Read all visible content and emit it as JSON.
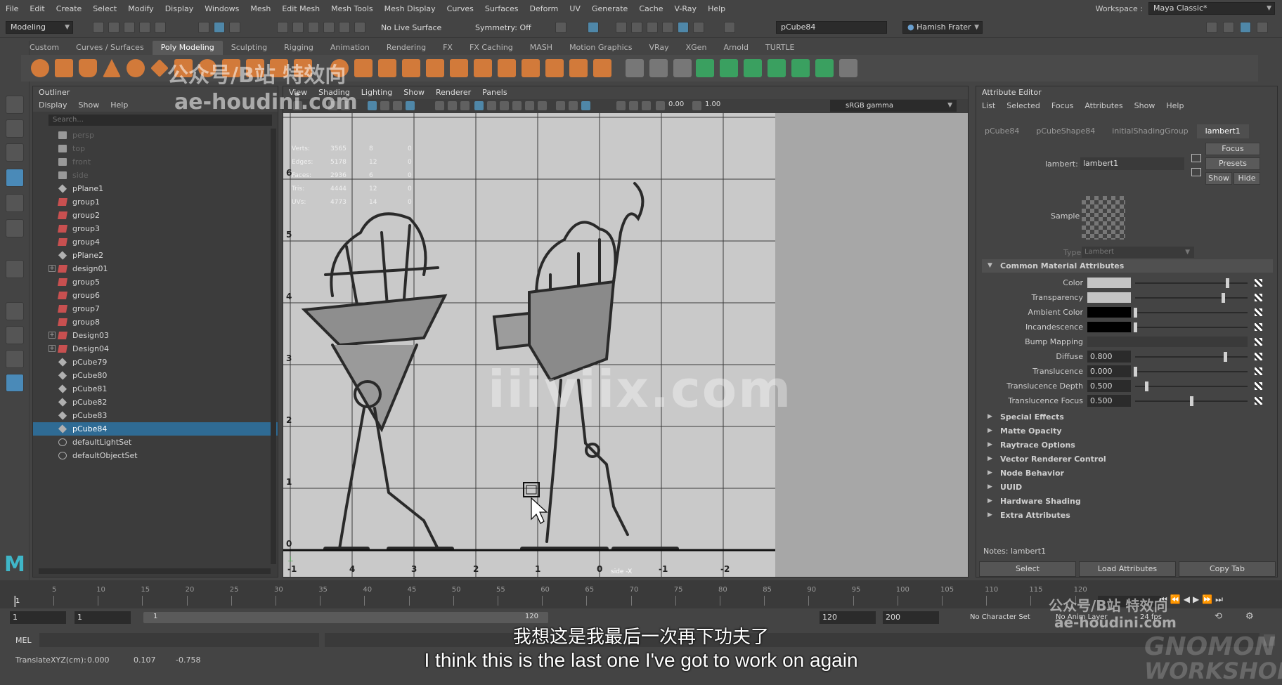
{
  "menubar": {
    "items": [
      "File",
      "Edit",
      "Create",
      "Select",
      "Modify",
      "Display",
      "Windows",
      "Mesh",
      "Edit Mesh",
      "Mesh Tools",
      "Mesh Display",
      "Curves",
      "Surfaces",
      "Deform",
      "UV",
      "Generate",
      "Cache",
      "V-Ray",
      "Help"
    ],
    "workspace_label": "Workspace :",
    "workspace_value": "Maya Classic*"
  },
  "statusline": {
    "mode": "Modeling",
    "live_surface": "No Live Surface",
    "symmetry": "Symmetry: Off",
    "selected_name": "pCube84",
    "user": "Hamish Frater"
  },
  "shelf": {
    "tabs": [
      "Custom",
      "Curves / Surfaces",
      "Poly Modeling",
      "Sculpting",
      "Rigging",
      "Animation",
      "Rendering",
      "FX",
      "FX Caching",
      "MASH",
      "Motion Graphics",
      "VRay",
      "XGen",
      "Arnold",
      "TURTLE"
    ],
    "active_tab": 2
  },
  "outliner": {
    "title": "Outliner",
    "menu": [
      "Display",
      "Show",
      "Help"
    ],
    "search_placeholder": "Search...",
    "items": [
      {
        "label": "persp",
        "icon": "camera-icon",
        "dim": true
      },
      {
        "label": "top",
        "icon": "camera-icon",
        "dim": true
      },
      {
        "label": "front",
        "icon": "camera-icon",
        "dim": true
      },
      {
        "label": "side",
        "icon": "camera-icon",
        "dim": true
      },
      {
        "label": "pPlane1",
        "icon": "mesh-icon"
      },
      {
        "label": "group1",
        "icon": "group-icon"
      },
      {
        "label": "group2",
        "icon": "group-icon"
      },
      {
        "label": "group3",
        "icon": "group-icon"
      },
      {
        "label": "group4",
        "icon": "group-icon"
      },
      {
        "label": "pPlane2",
        "icon": "mesh-icon"
      },
      {
        "label": "design01",
        "icon": "group-icon",
        "expand": true
      },
      {
        "label": "group5",
        "icon": "group-icon"
      },
      {
        "label": "group6",
        "icon": "group-icon"
      },
      {
        "label": "group7",
        "icon": "group-icon"
      },
      {
        "label": "group8",
        "icon": "group-icon"
      },
      {
        "label": "Design03",
        "icon": "group-icon",
        "expand": true
      },
      {
        "label": "Design04",
        "icon": "group-icon",
        "expand": true
      },
      {
        "label": "pCube79",
        "icon": "mesh-icon"
      },
      {
        "label": "pCube80",
        "icon": "mesh-icon"
      },
      {
        "label": "pCube81",
        "icon": "mesh-icon"
      },
      {
        "label": "pCube82",
        "icon": "mesh-icon"
      },
      {
        "label": "pCube83",
        "icon": "mesh-icon"
      },
      {
        "label": "pCube84",
        "icon": "mesh-icon",
        "selected": true
      },
      {
        "label": "defaultLightSet",
        "icon": "set-icon"
      },
      {
        "label": "defaultObjectSet",
        "icon": "set-icon"
      }
    ]
  },
  "viewport": {
    "menu": [
      "View",
      "Shading",
      "Lighting",
      "Show",
      "Renderer",
      "Panels"
    ],
    "field_a": "0.00",
    "field_b": "1.00",
    "color_space": "sRGB gamma",
    "hud": [
      {
        "label": "Verts:",
        "a": "3565",
        "b": "8",
        "c": "0"
      },
      {
        "label": "Edges:",
        "a": "5178",
        "b": "12",
        "c": "0"
      },
      {
        "label": "Faces:",
        "a": "2936",
        "b": "6",
        "c": "0"
      },
      {
        "label": "Tris:",
        "a": "4444",
        "b": "12",
        "c": "0"
      },
      {
        "label": "UVs:",
        "a": "4773",
        "b": "14",
        "c": "0"
      }
    ],
    "grid_y": [
      "6",
      "5",
      "4",
      "3",
      "2",
      "1",
      "0"
    ],
    "grid_x": [
      "-1",
      "4",
      "3",
      "2",
      "1",
      "0",
      "-1",
      "-2"
    ],
    "camera_label": "side -X"
  },
  "attribute_editor": {
    "title": "Attribute Editor",
    "menu": [
      "List",
      "Selected",
      "Focus",
      "Attributes",
      "Show",
      "Help"
    ],
    "tabs": [
      "pCube84",
      "pCubeShape84",
      "initialShadingGroup",
      "lambert1"
    ],
    "active_tab": 3,
    "node_label": "lambert:",
    "node_value": "lambert1",
    "focus_btn": "Focus",
    "presets_btn": "Presets",
    "show_btn": "Show",
    "hide_btn": "Hide",
    "sample_label": "Sample",
    "type_label": "Type",
    "type_value": "Lambert",
    "common_section": "Common Material Attributes",
    "attrs": [
      {
        "label": "Color",
        "swatch": "#c4c4c4",
        "level": 0.82
      },
      {
        "label": "Transparency",
        "swatch": "#c4c4c4",
        "level": 0.78
      },
      {
        "label": "Ambient Color",
        "swatch": "#000000",
        "level": 0.0
      },
      {
        "label": "Incandescence",
        "swatch": "#000000",
        "level": 0.0
      },
      {
        "label": "Bump Mapping",
        "swatch": "",
        "level": null
      },
      {
        "label": "Diffuse",
        "value": "0.800",
        "level": 0.8
      },
      {
        "label": "Translucence",
        "value": "0.000",
        "level": 0.0
      },
      {
        "label": "Translucence Depth",
        "value": "0.500",
        "level": 0.1
      },
      {
        "label": "Translucence Focus",
        "value": "0.500",
        "level": 0.5
      }
    ],
    "sections": [
      "Special Effects",
      "Matte Opacity",
      "Raytrace Options",
      "Vector Renderer Control",
      "Node Behavior",
      "UUID",
      "Hardware Shading",
      "Extra Attributes"
    ],
    "notes": "Notes:  lambert1",
    "buttons": [
      "Select",
      "Load Attributes",
      "Copy Tab"
    ]
  },
  "timeline": {
    "ticks": [
      "5",
      "10",
      "15",
      "20",
      "25",
      "30",
      "35",
      "40",
      "45",
      "50",
      "55",
      "60",
      "65",
      "70",
      "75",
      "80",
      "85",
      "90",
      "95",
      "100",
      "105",
      "110",
      "115",
      "120"
    ],
    "current_frame": "1",
    "start": "1",
    "range_start": "1",
    "range_inner": "1",
    "range_end_inner": "120",
    "end": "120",
    "max": "200",
    "char_set": "No Character Set",
    "anim_layer": "No Anim Layer",
    "fps": "24 fps"
  },
  "cmdline": {
    "label": "MEL"
  },
  "helpline": {
    "label": "TranslateXYZ(cm):",
    "x": "0.000",
    "y": "0.107",
    "z": "-0.758"
  },
  "overlay": {
    "subtitle_cn": "我想这是我最后一次再下功夫了",
    "subtitle_en": "I think this is the last one I've got to work on again",
    "wm_top1": "公众号/B站 特效向",
    "wm_top2": "ae-houdini.com",
    "wm_center": "iiiviix.com",
    "wm_br1": "公众号/B站 特效向",
    "wm_br2": "ae-houdini.com",
    "wm_brand1": "GNOMON",
    "wm_brand2": "WORKSHOP"
  }
}
